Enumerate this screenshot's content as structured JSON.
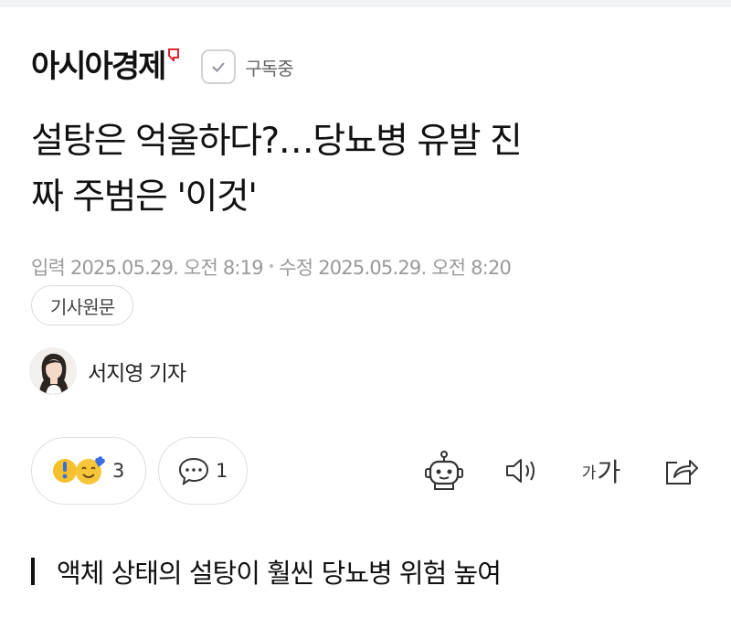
{
  "press": {
    "name": "아시아경제",
    "subscribe_label": "구독중",
    "brand_color": "#e1262c"
  },
  "article": {
    "headline_line1": "설탕은 억울하다?…당뇨병 유발 진",
    "headline_line2": "짜 주범은 '이것'",
    "input_label": "입력",
    "input_date": "2025.05.29. 오전 8:19",
    "modified_label": "수정",
    "modified_date": "2025.05.29. 오전 8:20",
    "original_link_label": "기사원문",
    "reporter": "서지영 기자",
    "subheading": "액체 상태의 설탕이 훨씬 당뇨병 위험 높여"
  },
  "reactions": {
    "emoji_count": "3",
    "comment_count": "1"
  },
  "tools": {
    "font_small": "가",
    "font_big": "가",
    "icons": [
      "robot-summary-icon",
      "speaker-icon",
      "font-size-icon",
      "share-icon"
    ]
  }
}
